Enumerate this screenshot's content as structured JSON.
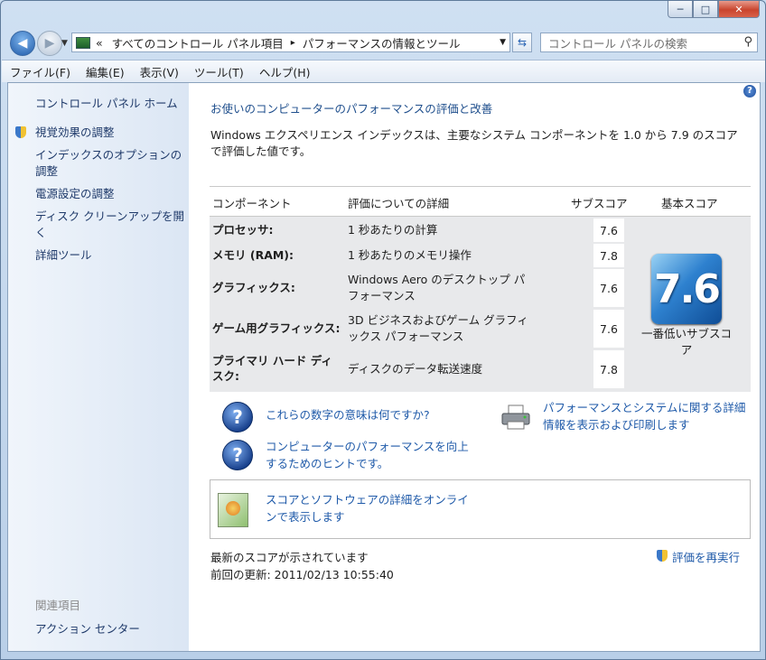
{
  "window": {
    "minimize": "─",
    "maximize": "□",
    "close": "✕"
  },
  "address": {
    "prefix": "«",
    "crumbs": [
      "すべてのコントロール パネル項目",
      "パフォーマンスの情報とツール"
    ],
    "separator": "▸"
  },
  "search": {
    "placeholder": "コントロール パネルの検索"
  },
  "menu": [
    "ファイル(F)",
    "編集(E)",
    "表示(V)",
    "ツール(T)",
    "ヘルプ(H)"
  ],
  "sidebar": {
    "home": "コントロール パネル ホーム",
    "items": [
      "視覚効果の調整",
      "インデックスのオプションの調整",
      "電源設定の調整",
      "ディスク クリーンアップを開く",
      "詳細ツール"
    ],
    "related_heading": "関連項目",
    "related": [
      "アクション センター"
    ]
  },
  "main": {
    "heading": "お使いのコンピューターのパフォーマンスの評価と改善",
    "description": "Windows エクスペリエンス インデックスは、主要なシステム コンポーネントを 1.0 から 7.9 のスコアで評価した値です。",
    "table": {
      "headers": [
        "コンポーネント",
        "評価についての詳細",
        "サブスコア",
        "基本スコア"
      ],
      "rows": [
        {
          "component": "プロセッサ:",
          "detail": "1 秒あたりの計算",
          "subscore": "7.6"
        },
        {
          "component": "メモリ (RAM):",
          "detail": "1 秒あたりのメモリ操作",
          "subscore": "7.8"
        },
        {
          "component": "グラフィックス:",
          "detail": "Windows Aero のデスクトップ パフォーマンス",
          "subscore": "7.6"
        },
        {
          "component": "ゲーム用グラフィックス:",
          "detail": "3D ビジネスおよびゲーム グラフィックス パフォーマンス",
          "subscore": "7.6"
        },
        {
          "component": "プライマリ ハード ディスク:",
          "detail": "ディスクのデータ転送速度",
          "subscore": "7.8"
        }
      ],
      "base_score": "7.6",
      "base_caption": "一番低いサブスコア"
    },
    "links": {
      "meaning": "これらの数字の意味は何ですか?",
      "tips": "コンピューターのパフォーマンスを向上するためのヒントです。",
      "print": "パフォーマンスとシステムに関する詳細情報を表示および印刷します",
      "online": "スコアとソフトウェアの詳細をオンラインで表示します"
    },
    "status": "最新のスコアが示されています",
    "last_update": "前回の更新: 2011/02/13 10:55:40",
    "rerun": "評価を再実行"
  }
}
